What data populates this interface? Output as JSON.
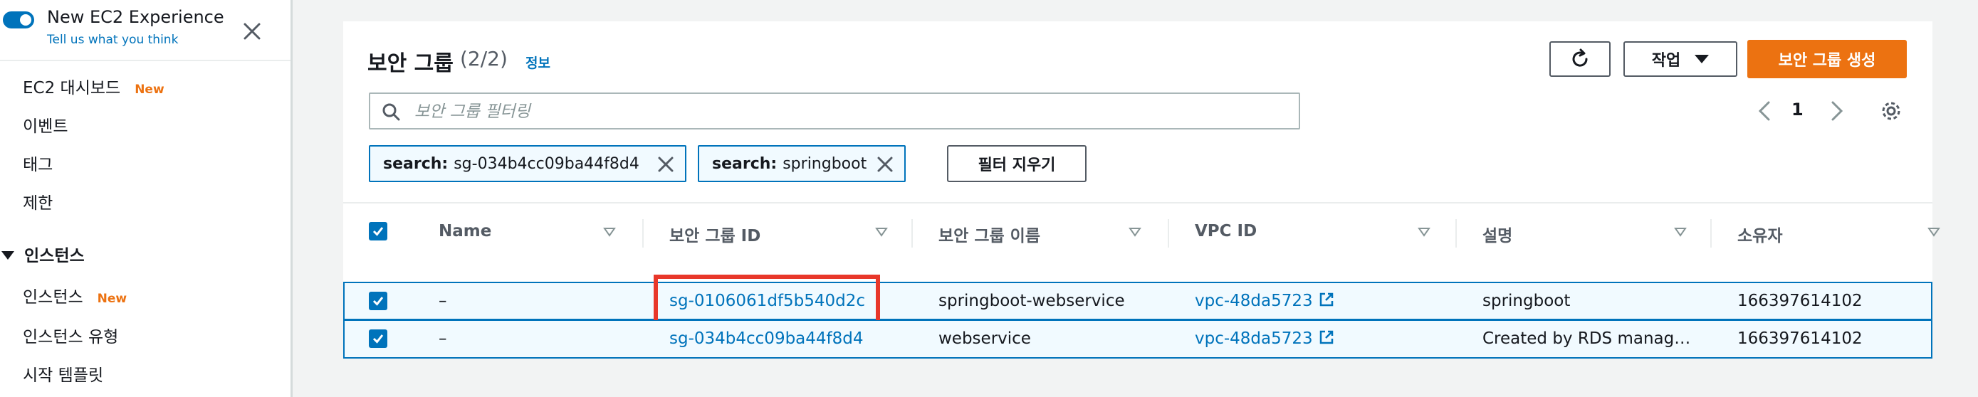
{
  "sidebar": {
    "experience_title": "New EC2 Experience",
    "experience_link": "Tell us what you think",
    "items": [
      {
        "label": "EC2 대시보드",
        "badge": "New"
      },
      {
        "label": "이벤트",
        "badge": ""
      },
      {
        "label": "태그",
        "badge": ""
      },
      {
        "label": "제한",
        "badge": ""
      }
    ],
    "section": "인스턴스",
    "section_items": [
      {
        "label": "인스턴스",
        "badge": "New"
      },
      {
        "label": "인스턴스 유형",
        "badge": ""
      },
      {
        "label": "시작 템플릿",
        "badge": ""
      }
    ]
  },
  "header": {
    "title": "보안 그룹",
    "count": "(2/2)",
    "info": "정보",
    "actions_label": "작업",
    "create_label": "보안 그룹 생성"
  },
  "search": {
    "placeholder": "보안 그룹 필터링",
    "value": ""
  },
  "pagination": {
    "page": "1"
  },
  "filters": {
    "tokens": [
      {
        "key": "search:",
        "value": "sg-034b4cc09ba44f8d4"
      },
      {
        "key": "search:",
        "value": "springboot"
      }
    ],
    "clear_label": "필터 지우기"
  },
  "table": {
    "columns": [
      "Name",
      "보안 그룹 ID",
      "보안 그룹 이름",
      "VPC ID",
      "설명",
      "소유자"
    ],
    "rows": [
      {
        "name": "–",
        "sg_id": "sg-0106061df5b540d2c",
        "sg_name": "springboot-webservice",
        "vpc_id": "vpc-48da5723",
        "description": "springboot",
        "owner": "166397614102",
        "selected": true,
        "highlighted": true
      },
      {
        "name": "–",
        "sg_id": "sg-034b4cc09ba44f8d4",
        "sg_name": "webservice",
        "vpc_id": "vpc-48da5723",
        "description": "Created by RDS manag…",
        "owner": "166397614102",
        "selected": true,
        "highlighted": false
      }
    ]
  },
  "colors": {
    "accent": "#0073bb",
    "primary_button": "#ec7211",
    "new_badge": "#ec7211",
    "highlight_box": "#e8372a",
    "selected_row_bg": "#f1faff"
  }
}
